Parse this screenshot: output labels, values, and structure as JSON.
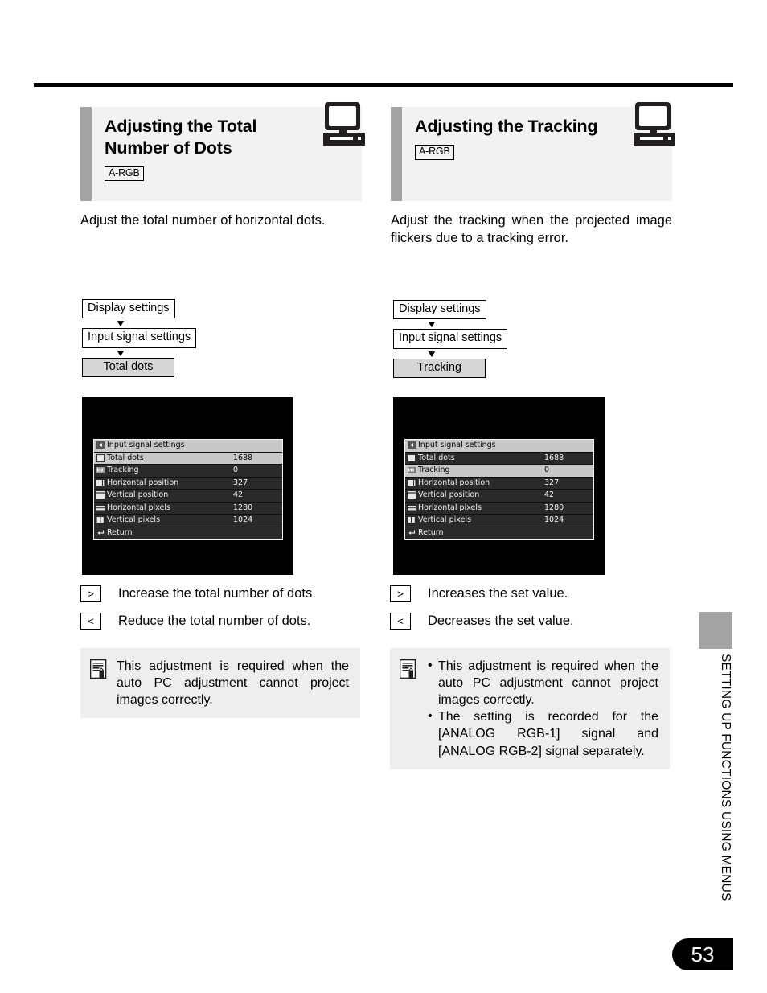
{
  "page": {
    "number": "53",
    "side_tab_label": "SETTING UP FUNCTIONS USING MENUS"
  },
  "sections": [
    {
      "title": "Adjusting the Total Number of Dots",
      "tag": "A-RGB",
      "icon": "desktop-computer-icon",
      "intro": "Adjust the total number of horizontal dots.",
      "flow": [
        {
          "label": "Display settings",
          "selected": false
        },
        {
          "label": "Input signal settings",
          "selected": false
        },
        {
          "label": "Total dots",
          "selected": true
        }
      ],
      "osd": {
        "title": "Input signal settings",
        "title_icon": "menu-return-icon",
        "rows": [
          {
            "icon": "total-dots-icon",
            "label": "Total dots",
            "value": "1688",
            "selected": true
          },
          {
            "icon": "tracking-icon",
            "label": "Tracking",
            "value": "0",
            "selected": false
          },
          {
            "icon": "h-position-icon",
            "label": "Horizontal position",
            "value": "327",
            "selected": false
          },
          {
            "icon": "v-position-icon",
            "label": "Vertical position",
            "value": "42",
            "selected": false
          },
          {
            "icon": "h-pixels-icon",
            "label": "Horizontal pixels",
            "value": "1280",
            "selected": false
          },
          {
            "icon": "v-pixels-icon",
            "label": "Vertical pixels",
            "value": "1024",
            "selected": false
          },
          {
            "icon": "return-icon",
            "label": "Return",
            "value": "",
            "selected": false
          }
        ]
      },
      "keys": [
        {
          "key": ">",
          "text": "Increase the total number of dots."
        },
        {
          "key": "<",
          "text": "Reduce the total number of dots."
        }
      ],
      "note": {
        "icon": "memo-note-icon",
        "bulleted": false,
        "items": [
          "This adjustment is required when the auto PC adjustment cannot project images correctly."
        ]
      }
    },
    {
      "title": "Adjusting the Tracking",
      "tag": "A-RGB",
      "icon": "desktop-computer-icon",
      "intro": "Adjust the tracking when the projected image flickers due to a tracking error.",
      "flow": [
        {
          "label": "Display settings",
          "selected": false
        },
        {
          "label": "Input signal settings",
          "selected": false
        },
        {
          "label": "Tracking",
          "selected": true
        }
      ],
      "osd": {
        "title": "Input signal settings",
        "title_icon": "menu-return-icon",
        "rows": [
          {
            "icon": "total-dots-icon",
            "label": "Total dots",
            "value": "1688",
            "selected": false
          },
          {
            "icon": "tracking-icon",
            "label": "Tracking",
            "value": "0",
            "selected": true
          },
          {
            "icon": "h-position-icon",
            "label": "Horizontal position",
            "value": "327",
            "selected": false
          },
          {
            "icon": "v-position-icon",
            "label": "Vertical position",
            "value": "42",
            "selected": false
          },
          {
            "icon": "h-pixels-icon",
            "label": "Horizontal pixels",
            "value": "1280",
            "selected": false
          },
          {
            "icon": "v-pixels-icon",
            "label": "Vertical pixels",
            "value": "1024",
            "selected": false
          },
          {
            "icon": "return-icon",
            "label": "Return",
            "value": "",
            "selected": false
          }
        ]
      },
      "keys": [
        {
          "key": ">",
          "text": "Increases the set value."
        },
        {
          "key": "<",
          "text": "Decreases the set value."
        }
      ],
      "note": {
        "icon": "memo-note-icon",
        "bulleted": true,
        "items": [
          "This adjustment is required when the auto PC adjustment cannot project images correctly.",
          "The setting is recorded for the [ANALOG RGB-1] signal and [ANALOG RGB-2] signal separately."
        ]
      }
    }
  ],
  "colors": {
    "header_band": "#f2f2f2",
    "header_bar": "#a3a3a3",
    "note_bg": "#eeeeee",
    "selected_flow": "#d6d6d6",
    "osd_selected": "#c8c8c8",
    "osd_row": "#2a2a2a"
  }
}
